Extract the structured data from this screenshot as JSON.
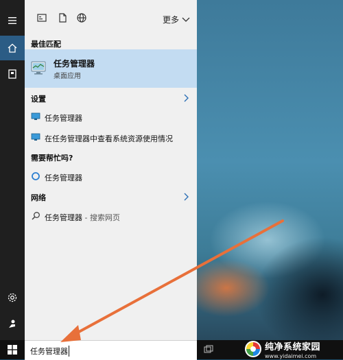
{
  "top_bar": {
    "more_label": "更多"
  },
  "best_match": {
    "header": "最佳匹配",
    "title": "任务管理器",
    "subtitle": "桌面应用"
  },
  "settings": {
    "header": "设置",
    "items": [
      {
        "label": "任务管理器"
      },
      {
        "label": "在任务管理器中查看系统资源使用情况"
      }
    ]
  },
  "help": {
    "header": "需要帮忙吗?",
    "items": [
      {
        "label": "任务管理器"
      }
    ]
  },
  "web": {
    "header": "网络",
    "items": [
      {
        "label": "任务管理器",
        "suffix": " - 搜索网页"
      }
    ]
  },
  "search": {
    "value": "任务管理器"
  },
  "watermark": {
    "text": "纯净系统家园",
    "url": "www.yidaimei.com"
  },
  "colors": {
    "accent": "#2b5c85",
    "selection": "#c3dcf2",
    "arrow": "#e8703a"
  }
}
